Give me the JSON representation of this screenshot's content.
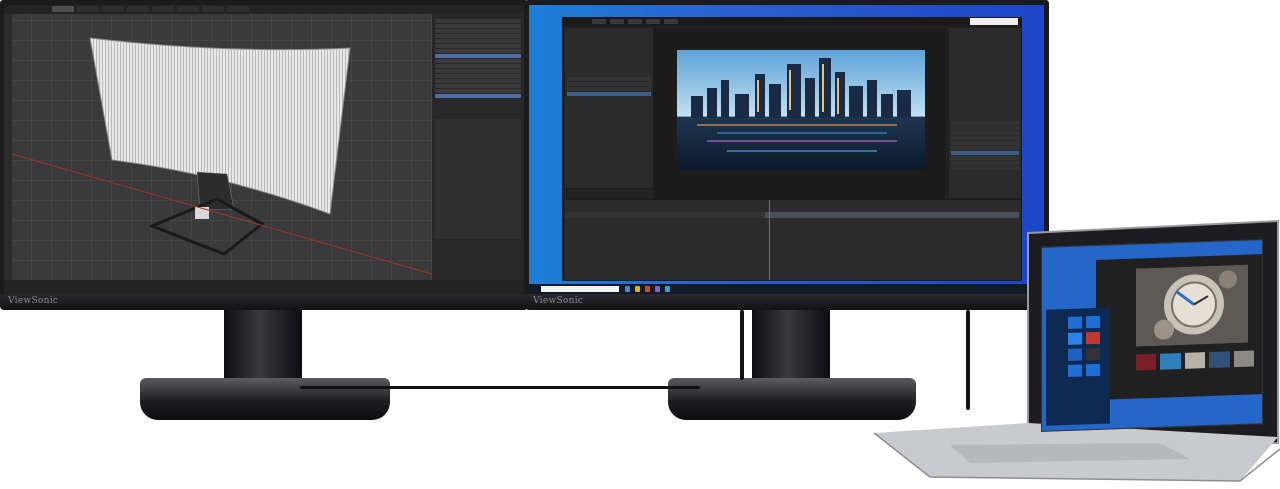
{
  "monitor_left": {
    "brand": "ViewSonic",
    "screen_colors": {
      "app_bg": "#3c3c3c",
      "panel": "#282828",
      "selection": "#4a6fa5"
    }
  },
  "monitor_center": {
    "brand": "ViewSonic",
    "screen_colors": {
      "desktop": "#1b5fd0",
      "app_bg": "#232323"
    }
  },
  "laptop": {
    "screen_colors": {
      "desktop": "#2566c9",
      "start_menu": "#0e2a52"
    }
  }
}
